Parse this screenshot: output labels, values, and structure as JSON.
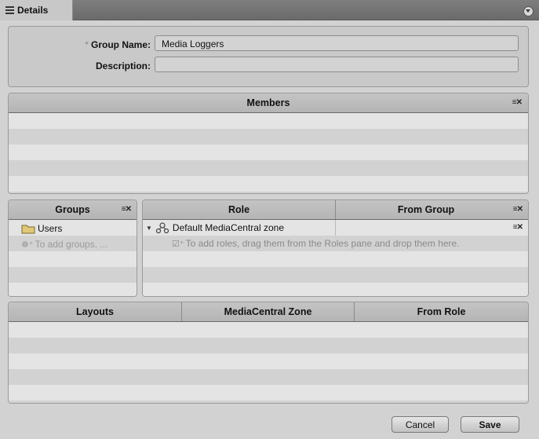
{
  "tab": {
    "label": "Details"
  },
  "form": {
    "group_name_label": "Group Name:",
    "required_mark": "*",
    "group_name_value": "Media Loggers",
    "description_label": "Description:",
    "description_value": ""
  },
  "members": {
    "header": "Members"
  },
  "groups": {
    "header": "Groups",
    "items": [
      "Users"
    ],
    "hint": "To add groups, ..."
  },
  "roles": {
    "headers": [
      "Role",
      "From Group"
    ],
    "zone": "Default MediaCentral zone",
    "hint": "To add roles, drag them from the Roles pane and drop them here."
  },
  "layouts": {
    "headers": [
      "Layouts",
      "MediaCentral Zone",
      "From Role"
    ]
  },
  "buttons": {
    "cancel": "Cancel",
    "save": "Save"
  }
}
